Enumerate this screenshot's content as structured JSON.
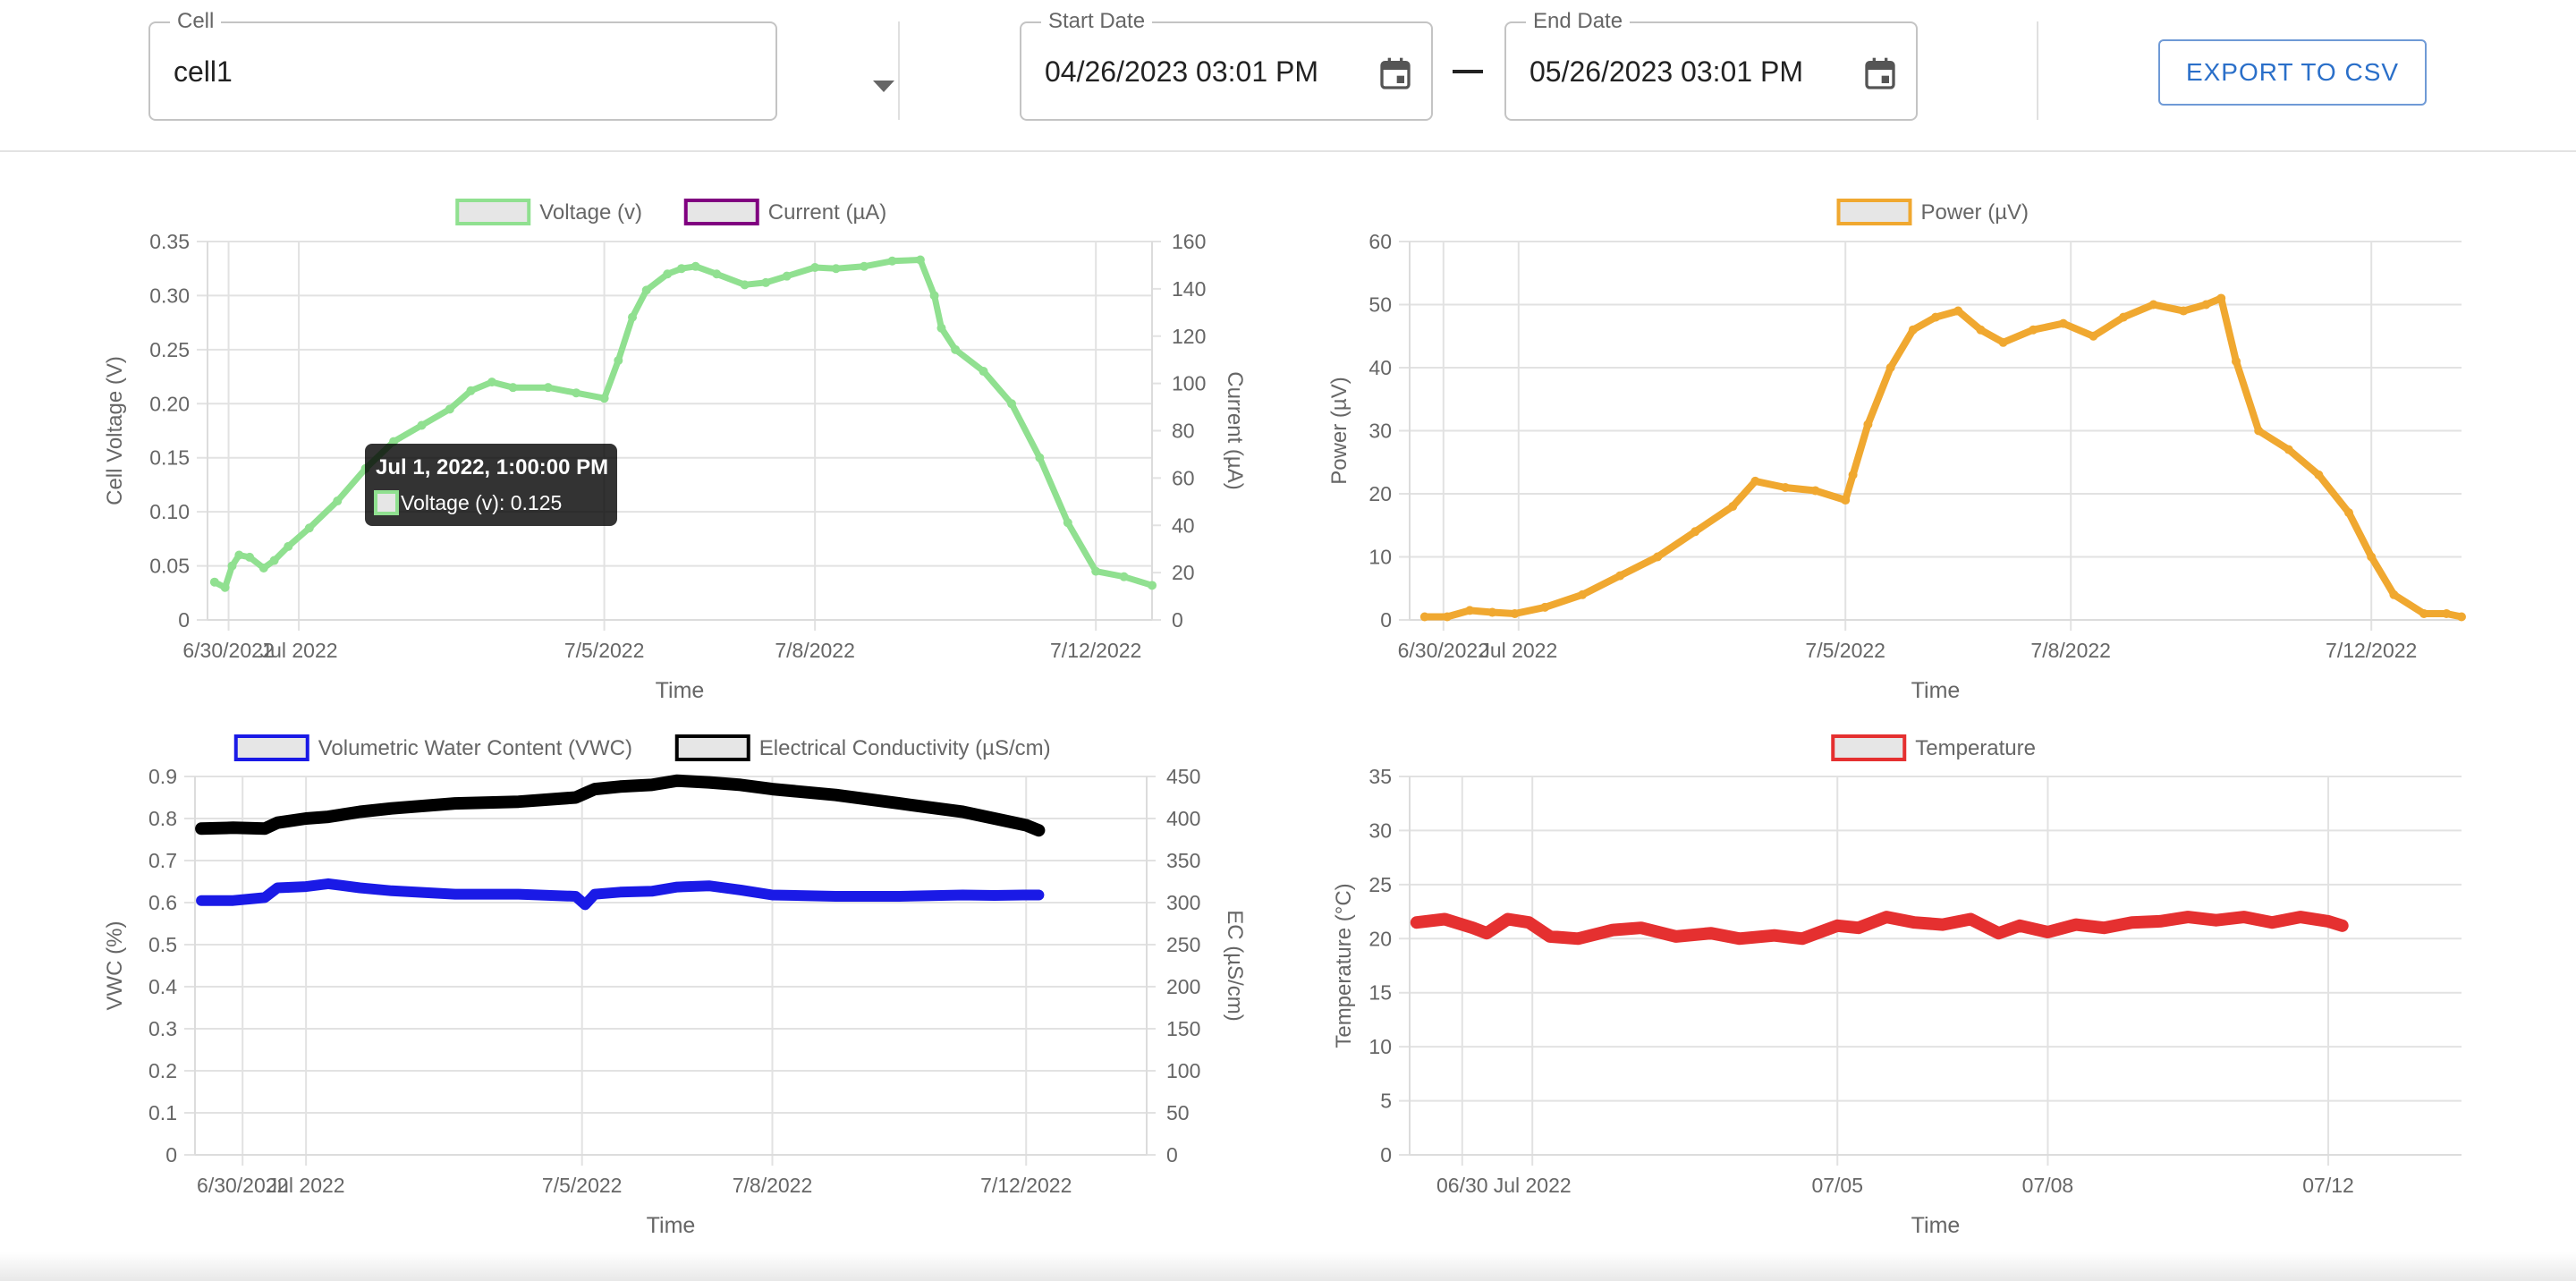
{
  "toolbar": {
    "cell": {
      "label": "Cell",
      "value": "cell1"
    },
    "start_date": {
      "label": "Start Date",
      "value": "04/26/2023 03:01 PM"
    },
    "end_date": {
      "label": "End Date",
      "value": "05/26/2023 03:01 PM"
    },
    "export_label": "EXPORT TO CSV"
  },
  "chart_data": [
    {
      "id": "voltage-current",
      "type": "line",
      "legend": [
        "Voltage (v)",
        "Current (µA)"
      ],
      "xlabel": "Time",
      "ylabel": "Cell Voltage (V)",
      "y2label": "Current (µA)",
      "x_ticks": [
        "6/30/2022",
        "Jul 2022",
        "7/5/2022",
        "7/8/2022",
        "7/12/2022"
      ],
      "x_tick_days": [
        -0.35,
        0.65,
        5,
        8,
        12
      ],
      "x_range_days": [
        -0.65,
        12.8
      ],
      "ylim": [
        0,
        0.35
      ],
      "y_ticks": [
        "0",
        "0.05",
        "0.10",
        "0.15",
        "0.20",
        "0.25",
        "0.30",
        "0.35"
      ],
      "y2lim": [
        0,
        160
      ],
      "y2_ticks": [
        "0",
        "20",
        "40",
        "60",
        "80",
        "100",
        "120",
        "140",
        "160"
      ],
      "colors": {
        "voltage": "#90e090",
        "current": "#5a5a5a"
      },
      "legend_colors": [
        "#90e090",
        "#800080"
      ],
      "grid": true,
      "series_x_days": [
        -0.55,
        -0.4,
        -0.3,
        -0.2,
        -0.05,
        0.15,
        0.3,
        0.5,
        0.8,
        1.2,
        1.6,
        2,
        2.4,
        2.8,
        3.1,
        3.4,
        3.7,
        4.2,
        4.6,
        5,
        5.2,
        5.4,
        5.6,
        5.9,
        6.1,
        6.3,
        6.6,
        7,
        7.3,
        7.6,
        8,
        8.3,
        8.7,
        9.1,
        9.5,
        9.7,
        9.8,
        10,
        10.4,
        10.8,
        11.2,
        11.6,
        12,
        12.4,
        12.8
      ],
      "series": [
        {
          "name": "Voltage (v)",
          "values": [
            0.035,
            0.03,
            0.05,
            0.06,
            0.058,
            0.048,
            0.055,
            0.068,
            0.085,
            0.11,
            0.14,
            0.165,
            0.18,
            0.195,
            0.212,
            0.22,
            0.215,
            0.215,
            0.21,
            0.205,
            0.24,
            0.28,
            0.305,
            0.32,
            0.325,
            0.327,
            0.32,
            0.31,
            0.312,
            0.318,
            0.326,
            0.325,
            0.327,
            0.332,
            0.333,
            0.3,
            0.27,
            0.25,
            0.23,
            0.2,
            0.15,
            0.09,
            0.045,
            0.04,
            0.032
          ]
        },
        {
          "name": "Current (µA)",
          "values": [
            16,
            14,
            23,
            28,
            27,
            22,
            25,
            31,
            39,
            50,
            64,
            75,
            82,
            89,
            97,
            101,
            98,
            98,
            96,
            94,
            110,
            128,
            140,
            146,
            149,
            150,
            146,
            142,
            143,
            145,
            149,
            149,
            150,
            152,
            153,
            137,
            123,
            114,
            105,
            91,
            69,
            41,
            21,
            18,
            15
          ]
        }
      ],
      "tooltip": {
        "title": "Jul 1, 2022, 1:00:00 PM",
        "label": "Voltage (v): 0.125"
      }
    },
    {
      "id": "power",
      "type": "line",
      "legend": [
        "Power (µV)"
      ],
      "xlabel": "Time",
      "ylabel": "Power (µV)",
      "x_ticks": [
        "6/30/2022",
        "Jul 2022",
        "7/5/2022",
        "7/8/2022",
        "7/12/2022"
      ],
      "x_tick_days": [
        -0.35,
        0.65,
        5,
        8,
        12
      ],
      "x_range_days": [
        -0.8,
        13.2
      ],
      "ylim": [
        0,
        60
      ],
      "y_ticks": [
        "0",
        "10",
        "20",
        "30",
        "40",
        "50",
        "60"
      ],
      "colors": {
        "power": "#f0a830"
      },
      "legend_colors": [
        "#f0a830"
      ],
      "grid": true,
      "series_x_days": [
        -0.6,
        -0.3,
        0,
        0.3,
        0.6,
        1,
        1.5,
        2,
        2.5,
        3,
        3.5,
        3.8,
        4.2,
        4.6,
        5,
        5.1,
        5.3,
        5.6,
        5.9,
        6.2,
        6.5,
        6.8,
        7.1,
        7.5,
        7.9,
        8.3,
        8.7,
        9.1,
        9.5,
        9.8,
        10.0,
        10.2,
        10.5,
        10.9,
        11.3,
        11.7,
        12.0,
        12.3,
        12.7,
        13.0,
        13.2
      ],
      "series": [
        {
          "name": "Power (µV)",
          "values": [
            0.5,
            0.5,
            1.5,
            1.2,
            1,
            2,
            4,
            7,
            10,
            14,
            18,
            22,
            21,
            20.5,
            19,
            23,
            31,
            40,
            46,
            48,
            49,
            46,
            44,
            46,
            47,
            45,
            48,
            50,
            49,
            50,
            51,
            41,
            30,
            27,
            23,
            17,
            10,
            4,
            1,
            1,
            0.5
          ]
        }
      ]
    },
    {
      "id": "vwc-ec",
      "type": "line",
      "legend": [
        "Volumetric Water Content (VWC)",
        "Electrical Conductivity (µS/cm)"
      ],
      "xlabel": "Time",
      "ylabel": "VWC (%)",
      "y2label": "EC (µS/cm)",
      "x_ticks": [
        "6/30/2022",
        "Jul 2022",
        "7/5/2022",
        "7/8/2022",
        "7/12/2022"
      ],
      "x_tick_days": [
        -0.35,
        0.65,
        5,
        8,
        12
      ],
      "x_range_days": [
        -1.1,
        13.9
      ],
      "ylim": [
        0,
        0.9
      ],
      "y_ticks": [
        "0",
        "0.1",
        "0.2",
        "0.3",
        "0.4",
        "0.5",
        "0.6",
        "0.7",
        "0.8",
        "0.9"
      ],
      "y2lim": [
        0,
        450
      ],
      "y2_ticks": [
        "0",
        "50",
        "100",
        "150",
        "200",
        "250",
        "300",
        "350",
        "400",
        "450"
      ],
      "colors": {
        "vwc": "#1a1ae6",
        "ec": "#000000"
      },
      "legend_colors": [
        "#1a1ae6",
        "#000000"
      ],
      "grid": true,
      "series_x_days": [
        -1,
        -0.5,
        0,
        0.2,
        0.65,
        1,
        1.5,
        2,
        3,
        4,
        4.9,
        5.05,
        5.2,
        5.6,
        6.1,
        6.5,
        7,
        7.5,
        8,
        9,
        10,
        11,
        11.5,
        12,
        12.2
      ],
      "series": [
        {
          "name": "Volumetric Water Content (VWC)",
          "values": [
            0.605,
            0.605,
            0.612,
            0.635,
            0.638,
            0.645,
            0.635,
            0.628,
            0.62,
            0.62,
            0.615,
            0.595,
            0.62,
            0.625,
            0.627,
            0.637,
            0.64,
            0.63,
            0.618,
            0.615,
            0.615,
            0.618,
            0.617,
            0.618,
            0.618
          ]
        },
        {
          "name": "Electrical Conductivity (µS/cm)",
          "values": [
            388,
            389,
            388,
            395,
            400,
            402,
            408,
            412,
            418,
            420,
            425,
            430,
            435,
            438,
            440,
            445,
            443,
            440,
            435,
            428,
            418,
            408,
            400,
            392,
            386
          ]
        }
      ]
    },
    {
      "id": "temperature",
      "type": "line",
      "legend": [
        "Temperature"
      ],
      "xlabel": "Time",
      "ylabel": "Temperature (°C)",
      "x_ticks": [
        "06/30",
        "Jul 2022",
        "07/05",
        "07/08",
        "07/12"
      ],
      "x_tick_days": [
        -0.35,
        0.65,
        5,
        8,
        12
      ],
      "x_range_days": [
        -1.1,
        13.9
      ],
      "ylim": [
        0,
        35
      ],
      "y_ticks": [
        "0",
        "5",
        "10",
        "15",
        "20",
        "25",
        "30",
        "35"
      ],
      "colors": {
        "temperature": "#e53030"
      },
      "legend_colors": [
        "#e53030"
      ],
      "grid": true,
      "series_x_days": [
        -1,
        -0.6,
        -0.2,
        0,
        0.3,
        0.6,
        0.9,
        1.3,
        1.8,
        2.2,
        2.7,
        3.2,
        3.6,
        4.1,
        4.5,
        5,
        5.3,
        5.7,
        6.1,
        6.5,
        6.9,
        7.3,
        7.6,
        8,
        8.4,
        8.8,
        9.2,
        9.6,
        10,
        10.4,
        10.8,
        11.2,
        11.6,
        12,
        12.2
      ],
      "series": [
        {
          "name": "Temperature",
          "values": [
            21.5,
            21.8,
            21.0,
            20.5,
            21.8,
            21.5,
            20.2,
            20.0,
            20.8,
            21.0,
            20.2,
            20.5,
            20.0,
            20.3,
            20.0,
            21.2,
            21.0,
            22.0,
            21.5,
            21.3,
            21.8,
            20.5,
            21.2,
            20.6,
            21.3,
            21.0,
            21.5,
            21.6,
            22.0,
            21.7,
            22.0,
            21.5,
            22.0,
            21.6,
            21.2
          ]
        }
      ]
    }
  ]
}
